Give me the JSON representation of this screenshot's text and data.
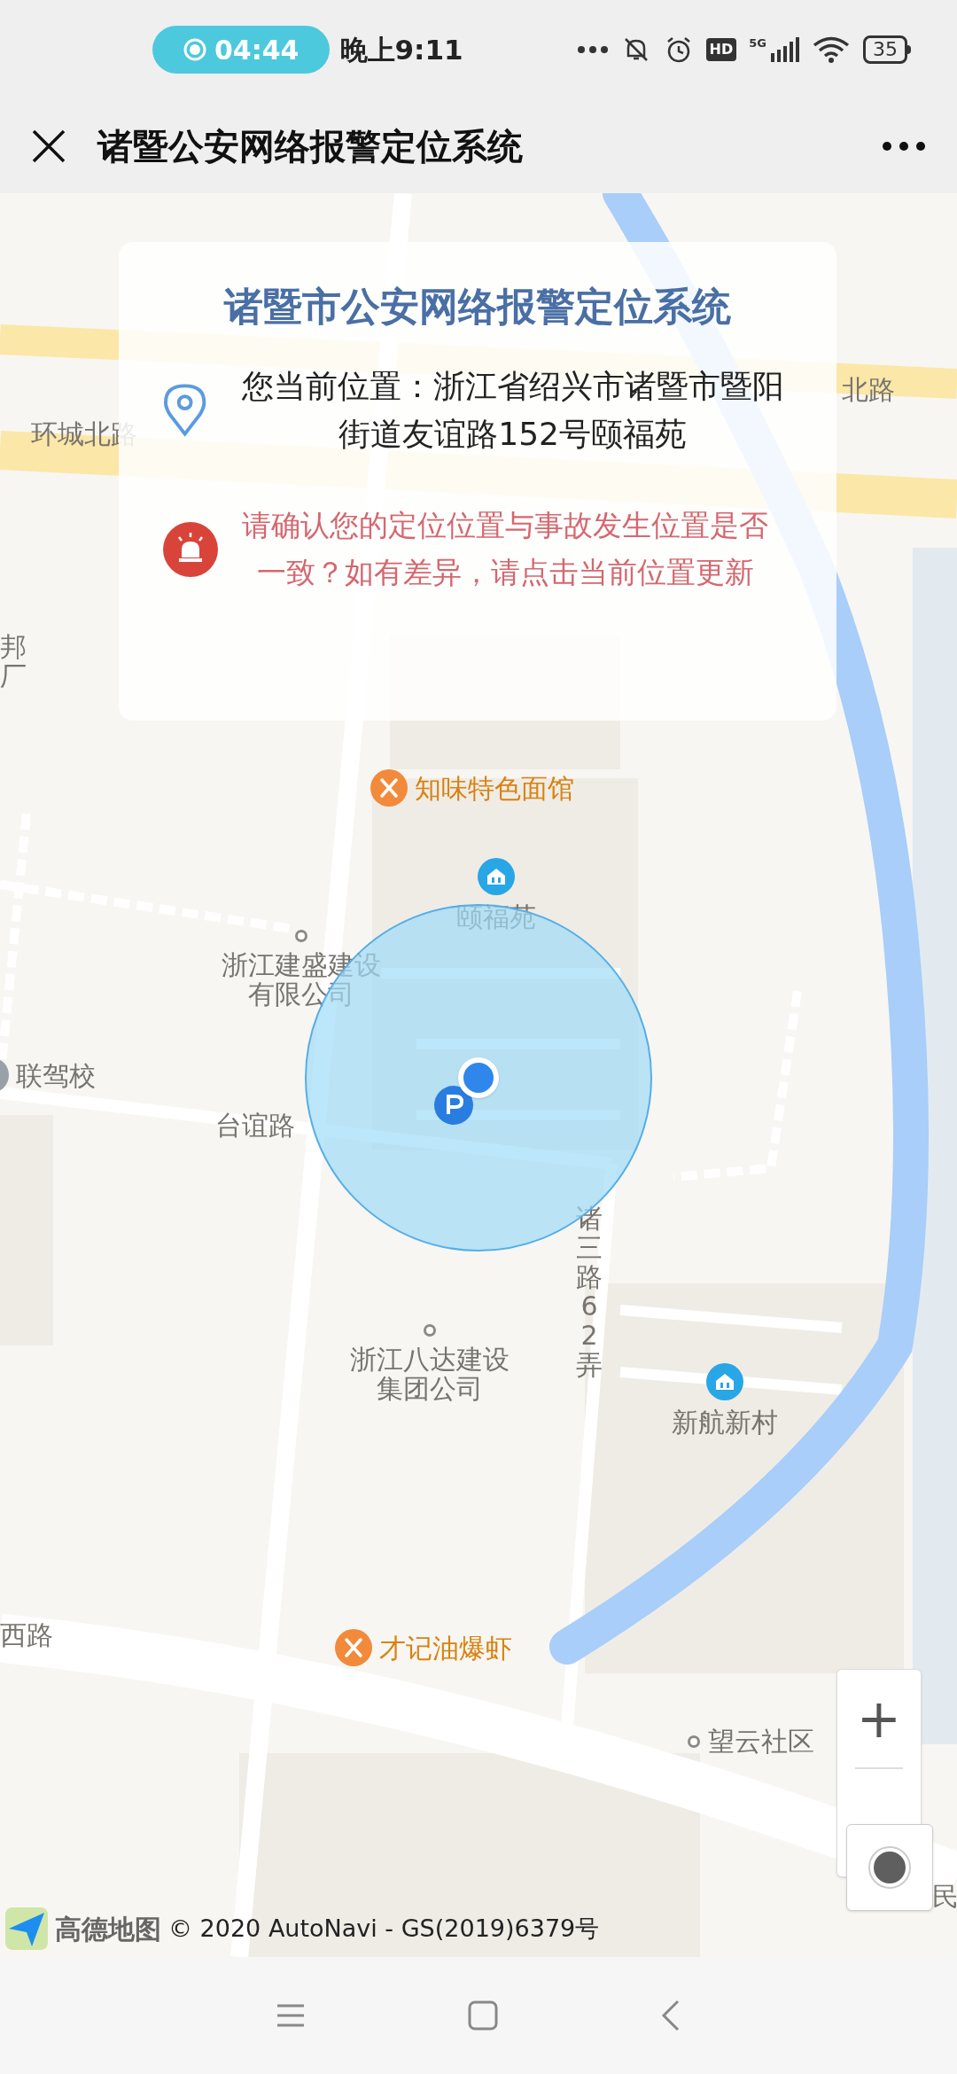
{
  "status_bar": {
    "recording_time": "04:44",
    "time": "晚上9:11",
    "hd_badge": "HD",
    "network": "5G",
    "battery": "35"
  },
  "header": {
    "title": "诸暨公安网络报警定位系统"
  },
  "info_card": {
    "title": "诸暨市公安网络报警定位系统",
    "location": "您当前位置：浙江省绍兴市诸暨市暨阳街道友谊路152号颐福苑",
    "warning": "请确认您的定位位置与事故发生位置是否一致？如有差异，请点击当前位置更新"
  },
  "map": {
    "labels": [
      {
        "text": "北路",
        "kind": "road"
      },
      {
        "text": "环城北路",
        "kind": "road"
      },
      {
        "text": "邦厂",
        "kind": "road"
      },
      {
        "text": "知味特色面馆",
        "kind": "restaurant"
      },
      {
        "text": "颐福苑",
        "kind": "residence"
      },
      {
        "text": "浙江建盛建设有限公司",
        "kind": "place"
      },
      {
        "text": "联驾校",
        "kind": "school"
      },
      {
        "text": "台谊路",
        "kind": "road"
      },
      {
        "text": "诸三路62弄",
        "kind": "road"
      },
      {
        "text": "浙江八达建设集团公司",
        "kind": "place"
      },
      {
        "text": "新航新村",
        "kind": "residence"
      },
      {
        "text": "西路",
        "kind": "road"
      },
      {
        "text": "才记油爆虾",
        "kind": "restaurant"
      },
      {
        "text": "望云社区",
        "kind": "place"
      },
      {
        "text": "民",
        "kind": "road"
      }
    ],
    "zoom_in": "+",
    "attribution": {
      "brand": "高德地图",
      "copyright": "© 2020 AutoNavi - GS(2019)6379号"
    }
  }
}
